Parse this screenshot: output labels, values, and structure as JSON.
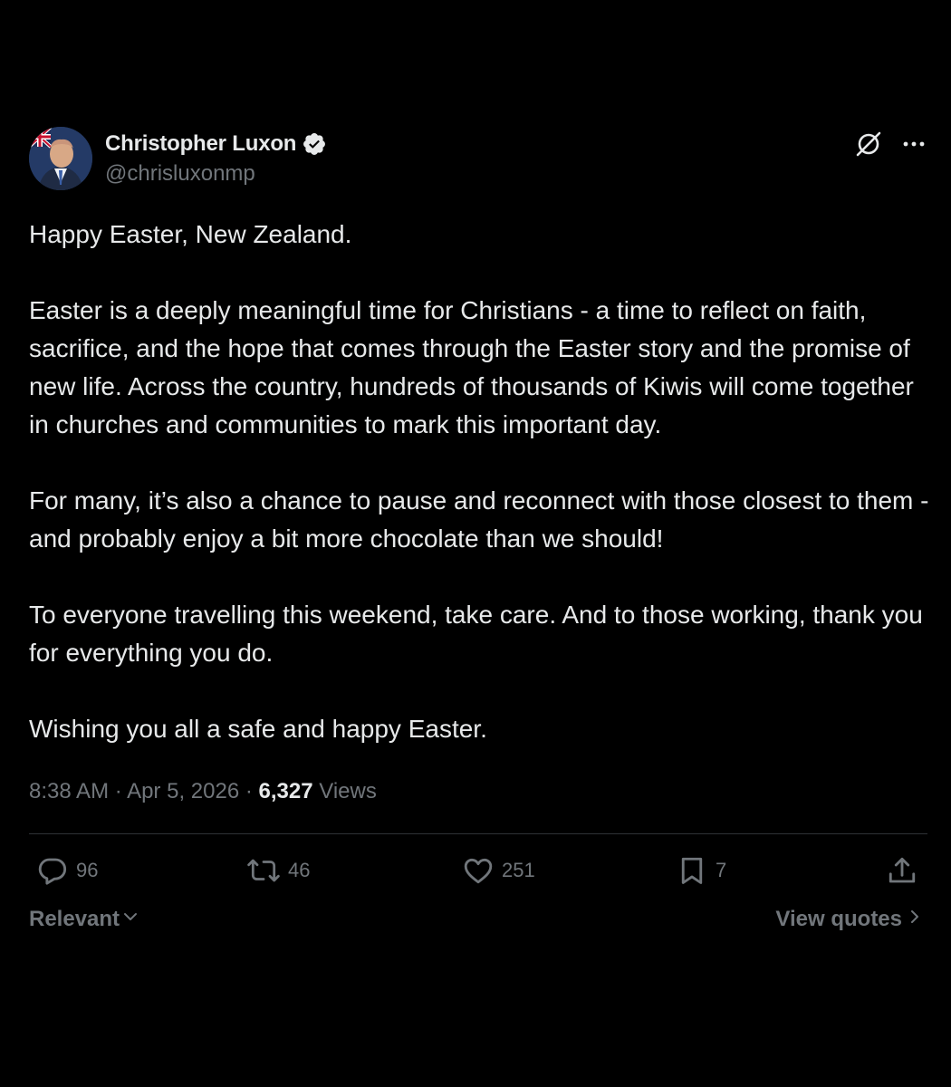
{
  "author": {
    "display_name": "Christopher Luxon",
    "handle": "@chrisluxonmp",
    "verified": true
  },
  "header_icons": {
    "grok": "grok-icon",
    "more": "more-icon"
  },
  "post": {
    "paragraphs": [
      "Happy Easter, New Zealand.",
      "Easter is a deeply meaningful time for Christians - a time to reflect on faith, sacrifice, and the hope that comes through the Easter story and the promise of new life. Across the country, hundreds of thousands of Kiwis will come together in churches and communities to mark this important day.",
      "For many, it’s also a chance to pause and reconnect with those closest to them - and probably enjoy a bit more chocolate than we should!",
      "To everyone travelling this weekend, take care. And to those working, thank you for everything you do.",
      "Wishing you all a safe and happy Easter."
    ],
    "time": "8:38 AM",
    "date": "Apr 5, 2026",
    "separator": "·",
    "views_count": "6,327",
    "views_label": "Views"
  },
  "actions": {
    "replies": "96",
    "reposts": "46",
    "likes": "251",
    "bookmarks": "7"
  },
  "footer": {
    "sort_label": "Relevant",
    "view_quotes_label": "View quotes"
  },
  "colors": {
    "background": "#000000",
    "text_primary": "#e7e9ea",
    "text_secondary": "#71767b",
    "divider": "#2f3336",
    "verified_badge": "#e7e9ea"
  }
}
